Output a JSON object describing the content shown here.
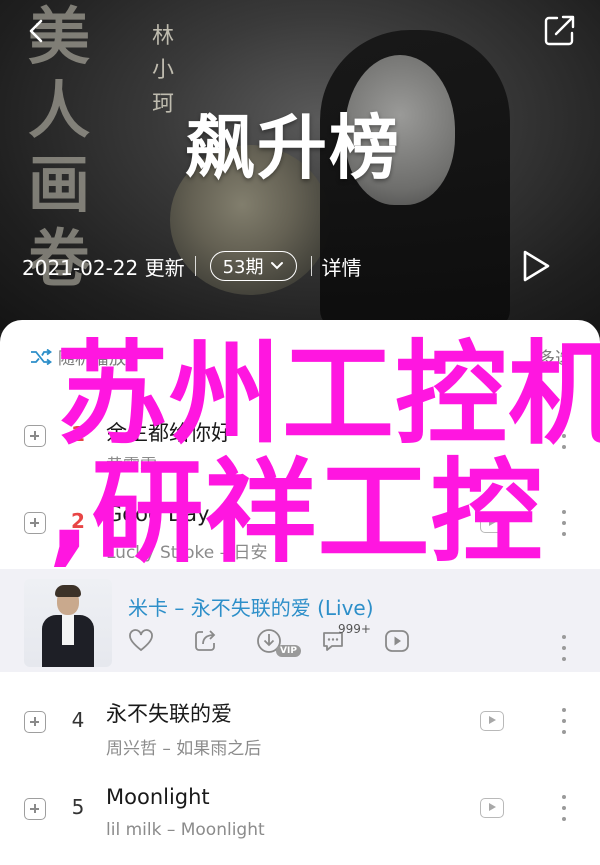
{
  "header": {
    "calligraphy": "美人画卷",
    "author": "林小珂",
    "headline": "飙升榜",
    "update_text": "2021-02-22 更新",
    "song_count": "53期",
    "details_label": "详情"
  },
  "list": {
    "shuffle_label": "随机播放",
    "multi_select_label": "多选",
    "rows": [
      {
        "rank": "1",
        "title": "余生都给你好",
        "artist": "黄霄雲"
      },
      {
        "rank": "2",
        "title": "Good Day",
        "artist": "Lucky Stroke – 日安"
      },
      {
        "rank": "4",
        "title": "永不失联的爱",
        "artist": "周兴哲 – 如果雨之后"
      },
      {
        "rank": "5",
        "title": "Moonlight",
        "artist": "lil milk – Moonlight"
      }
    ],
    "highlight": {
      "title": "米卡 – 永不失联的爱 (Live)",
      "comment_count": "999+",
      "vip_label": "VIP"
    }
  },
  "overlay": {
    "line1": "苏州工控机",
    "line2": ",研祥工控"
  },
  "colors": {
    "accent_blue": "#2d8fc9",
    "rank_red": "#e84545",
    "overlay_pink": "#ff16e0"
  },
  "icons": [
    "back-arrow-icon",
    "share-icon",
    "chevron-down-icon",
    "play-icon",
    "shuffle-icon",
    "add-icon",
    "mv-play-icon",
    "more-vertical-icon",
    "heart-icon",
    "share-out-icon",
    "download-icon",
    "comment-icon",
    "play-circle-icon"
  ]
}
